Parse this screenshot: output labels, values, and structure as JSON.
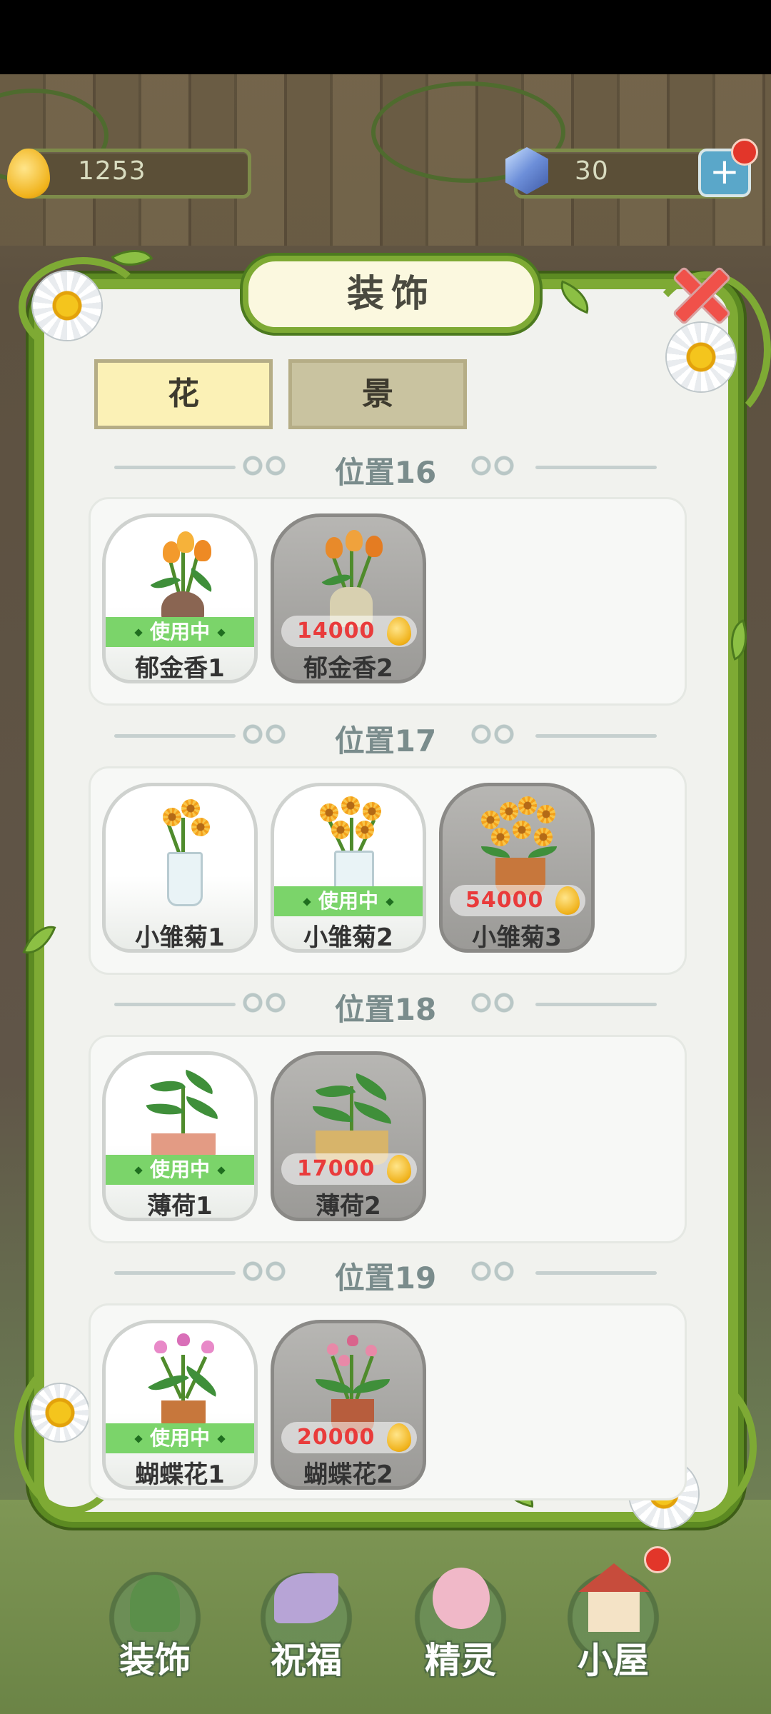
{
  "currency": {
    "water": "1253",
    "gems": "30",
    "plus_label": "+"
  },
  "panel": {
    "title": "装饰",
    "tabs": [
      {
        "label": "花",
        "active": true
      },
      {
        "label": "景",
        "active": false
      }
    ],
    "sections": [
      {
        "label": "位置16",
        "items": [
          {
            "name": "郁金香1",
            "status": "使用中",
            "price": ""
          },
          {
            "name": "郁金香2",
            "status": "",
            "price": "14000"
          }
        ]
      },
      {
        "label": "位置17",
        "items": [
          {
            "name": "小雏菊1",
            "status": "",
            "price": ""
          },
          {
            "name": "小雏菊2",
            "status": "使用中",
            "price": ""
          },
          {
            "name": "小雏菊3",
            "status": "",
            "price": "54000"
          }
        ]
      },
      {
        "label": "位置18",
        "items": [
          {
            "name": "薄荷1",
            "status": "使用中",
            "price": ""
          },
          {
            "name": "薄荷2",
            "status": "",
            "price": "17000"
          }
        ]
      },
      {
        "label": "位置19",
        "items": [
          {
            "name": "蝴蝶花1",
            "status": "使用中",
            "price": ""
          },
          {
            "name": "蝴蝶花2",
            "status": "",
            "price": "20000"
          }
        ]
      }
    ]
  },
  "bottom_nav": [
    {
      "label": "装饰",
      "icon": "plant-icon"
    },
    {
      "label": "祝福",
      "icon": "butterfly-icon"
    },
    {
      "label": "精灵",
      "icon": "fairy-icon"
    },
    {
      "label": "小屋",
      "icon": "house-icon"
    }
  ],
  "colors": {
    "vine_green": "#7eaa34",
    "in_use_green": "#7bd46a",
    "price_red": "#e93b3b"
  }
}
